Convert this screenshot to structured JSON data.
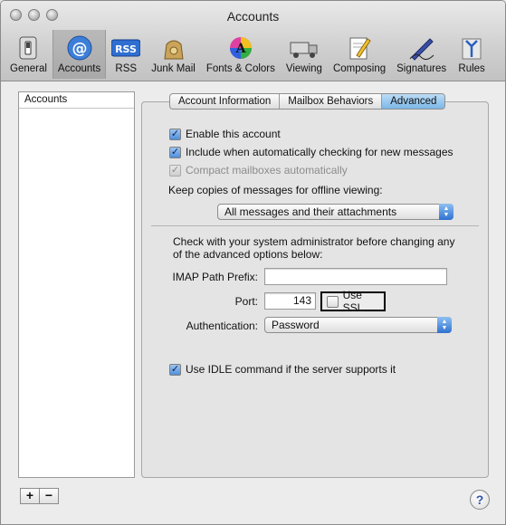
{
  "window": {
    "title": "Accounts"
  },
  "toolbar": {
    "items": [
      {
        "label": "General",
        "icon": "switch-icon"
      },
      {
        "label": "Accounts",
        "icon": "at-sign-icon",
        "selected": true
      },
      {
        "label": "RSS",
        "icon": "rss-icon"
      },
      {
        "label": "Junk Mail",
        "icon": "junk-bag-icon"
      },
      {
        "label": "Fonts & Colors",
        "icon": "font-color-icon"
      },
      {
        "label": "Viewing",
        "icon": "viewing-truck-icon"
      },
      {
        "label": "Composing",
        "icon": "compose-pencil-icon"
      },
      {
        "label": "Signatures",
        "icon": "signature-pen-icon"
      },
      {
        "label": "Rules",
        "icon": "rules-arrows-icon"
      }
    ]
  },
  "sidebar": {
    "header": "Accounts"
  },
  "tabs": [
    {
      "label": "Account Information"
    },
    {
      "label": "Mailbox Behaviors"
    },
    {
      "label": "Advanced",
      "active": true
    }
  ],
  "advanced": {
    "enable_account": "Enable this account",
    "include_checking": "Include when automatically checking for new messages",
    "compact_mailboxes": "Compact mailboxes automatically",
    "keep_copies_label": "Keep copies of messages for offline viewing:",
    "keep_copies_value": "All messages and their attachments",
    "note": "Check with your system administrator before changing any of the advanced options below:",
    "imap_prefix_label": "IMAP Path Prefix:",
    "imap_prefix_value": "",
    "port_label": "Port:",
    "port_value": "143",
    "use_ssl": "Use SSL",
    "auth_label": "Authentication:",
    "auth_value": "Password",
    "use_idle": "Use IDLE command if the server supports it"
  },
  "buttons": {
    "add": "+",
    "remove": "−",
    "help": "?"
  }
}
